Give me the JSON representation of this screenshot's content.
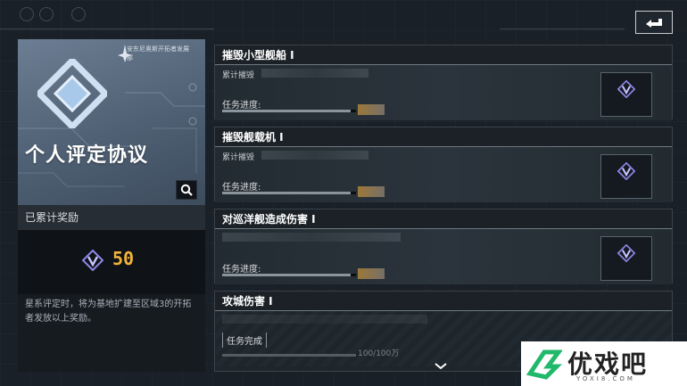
{
  "header": {
    "back_icon": "return-arrow-icon"
  },
  "card": {
    "org_name": "安东尼奥斯开拓者发展部",
    "title": "个人评定协议",
    "emblem_icon": "diamond-emblem-icon",
    "search_icon": "magnifier-icon"
  },
  "rewards": {
    "header": "已累计奖励",
    "icon": "v-badge-icon",
    "value": "50",
    "value_color": "#f2b33a",
    "description": "星系评定时，将为基地扩建至区域3的开拓者发放以上奖励。"
  },
  "missions": [
    {
      "title": "摧毁小型舰船 I",
      "count_label": "累计摧毁",
      "progress_label": "任务进度:",
      "status": "in-progress",
      "reward_icon": "v-badge-icon"
    },
    {
      "title": "摧毁舰载机 I",
      "count_label": "累计摧毁",
      "progress_label": "任务进度:",
      "status": "in-progress",
      "reward_icon": "v-badge-icon"
    },
    {
      "title": "对巡洋舰造成伤害 I",
      "count_label": "",
      "progress_label": "任务进度:",
      "status": "in-progress",
      "reward_icon": "v-badge-icon"
    },
    {
      "title": "攻城伤害 I",
      "done_label": "任务完成",
      "progress_value": "100/100万",
      "status": "completed"
    }
  ],
  "scroll_icon": "chevron-down-icon",
  "watermark": {
    "brand": "优戏吧",
    "url": "YOXI8.COM"
  },
  "colors": {
    "accent_gold": "#f2b33a",
    "badge_purple": "#8f86e8"
  }
}
